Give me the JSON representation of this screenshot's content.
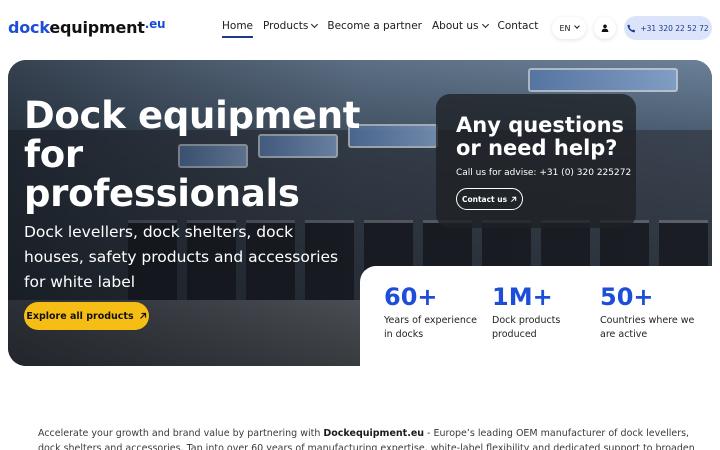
{
  "header": {
    "logo_part1": "dock",
    "logo_part2": "equipment",
    "logo_part3": ".eu",
    "nav": [
      {
        "label": "Home",
        "active": true,
        "dropdown": false
      },
      {
        "label": "Products",
        "active": false,
        "dropdown": true
      },
      {
        "label": "Become a partner",
        "active": false,
        "dropdown": false
      },
      {
        "label": "About us",
        "active": false,
        "dropdown": true
      },
      {
        "label": "Contact",
        "active": false,
        "dropdown": false
      }
    ],
    "language": "EN",
    "phone": "+31 320 22 52 72"
  },
  "hero": {
    "title": "Dock equipment for professionals",
    "subtitle": "Dock levellers, dock shelters, dock houses, safety products and accessories for white label",
    "cta_label": "Explore all products"
  },
  "help": {
    "title": "Any questions or need help?",
    "call_text": "Call us for advise:  +31 (0) 320 225272",
    "button_label": "Contact us"
  },
  "stats": [
    {
      "value": "60+",
      "label": "Years of experience in docks"
    },
    {
      "value": "1M+",
      "label": "Dock products produced"
    },
    {
      "value": "50+",
      "label": "Countries where we are active"
    }
  ],
  "intro": {
    "prefix": "Accelerate your growth and brand value by partnering with ",
    "brand": "Dockequipment.eu",
    "suffix": " - Europe’s leading OEM manufacturer of dock levellers, dock shelters and accessories. Tap into over 60 years of manufacturing expertise, white-label flexibility and dedicated support to broaden your product range and boost"
  },
  "colors": {
    "brand_blue": "#1d4ed8",
    "cta_yellow": "#f6be15",
    "phone_bg": "#dbe4fb"
  }
}
